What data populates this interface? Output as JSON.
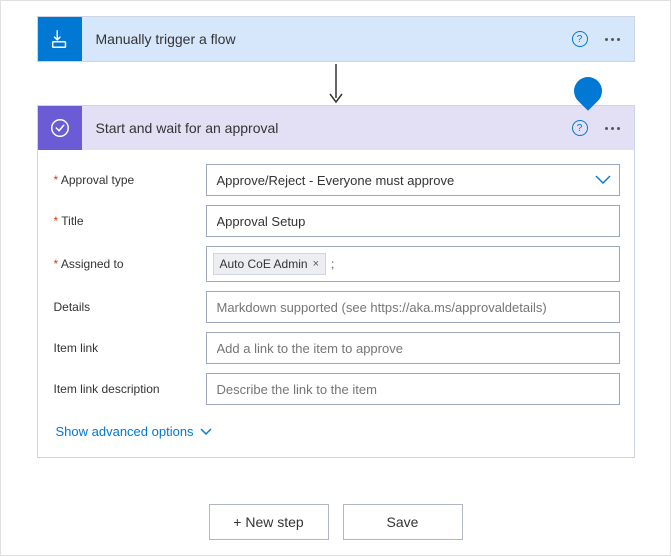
{
  "trigger": {
    "title": "Manually trigger a flow"
  },
  "action": {
    "title": "Start and wait for an approval",
    "fields": {
      "approvalType": {
        "label": "Approval type",
        "value": "Approve/Reject - Everyone must approve"
      },
      "title": {
        "label": "Title",
        "value": "Approval Setup"
      },
      "assignedTo": {
        "label": "Assigned to",
        "chip": "Auto CoE Admin",
        "suffix": ";"
      },
      "details": {
        "label": "Details",
        "placeholder": "Markdown supported (see https://aka.ms/approvaldetails)"
      },
      "itemLink": {
        "label": "Item link",
        "placeholder": "Add a link to the item to approve"
      },
      "itemLinkDesc": {
        "label": "Item link description",
        "placeholder": "Describe the link to the item"
      }
    },
    "advanced": "Show advanced options"
  },
  "footer": {
    "newStep": "+ New step",
    "save": "Save"
  },
  "glyphs": {
    "help": "?",
    "remove": "×"
  }
}
